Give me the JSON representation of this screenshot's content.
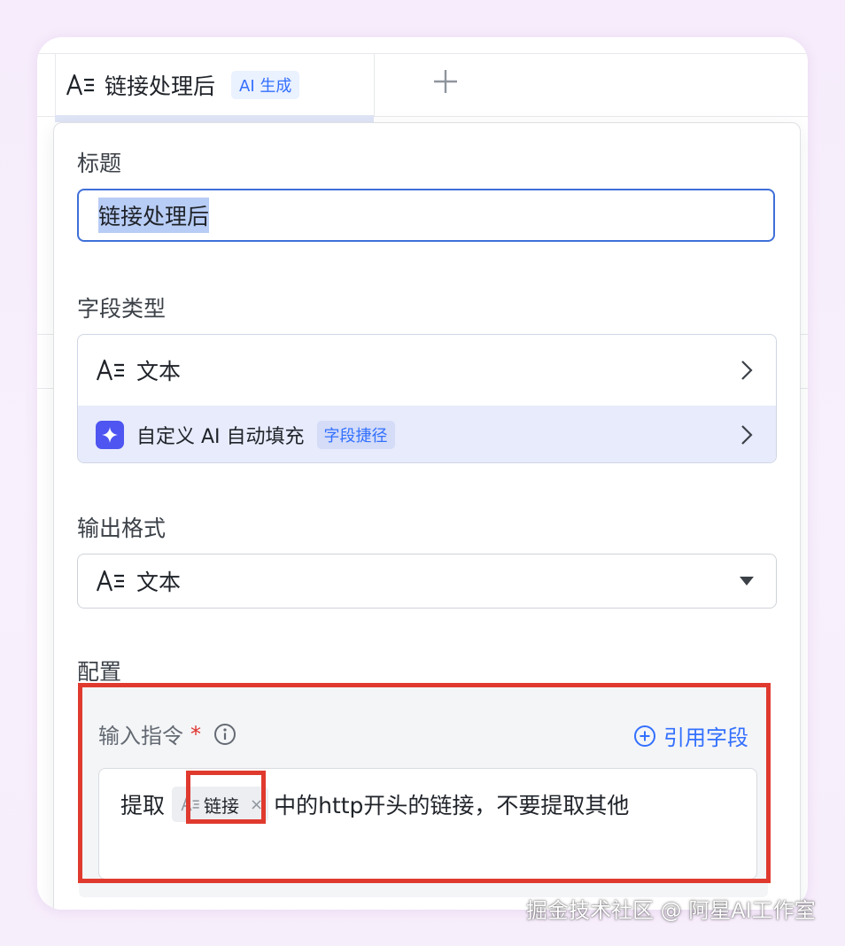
{
  "column_header": {
    "icon": "text-field-icon",
    "name": "链接处理后",
    "ai_tag": "AI 生成",
    "add_icon": "plus-icon"
  },
  "panel": {
    "title_label": "标题",
    "title_value": "链接处理后",
    "field_type_label": "字段类型",
    "field_type": {
      "icon": "text-field-icon",
      "value": "文本",
      "ai_autofill_label": "自定义 AI 自动填充",
      "ai_autofill_tag": "字段捷径"
    },
    "output_format_label": "输出格式",
    "output_format_value": "文本",
    "config_label": "配置",
    "instruction": {
      "label": "输入指令",
      "required_mark": "*",
      "info_icon": "info-icon",
      "ref_field_label": "引用字段",
      "text_before": "提取",
      "chip_label": "链接",
      "chip_remove": "×",
      "text_after": "中的http开头的链接，不要提取其他"
    }
  },
  "watermark": "掘金技术社区 @ 阿星AI工作室",
  "colors": {
    "accent": "#3370ff",
    "highlight_red": "#e03a2f",
    "ai_icon_bg": "#4e55f0"
  }
}
